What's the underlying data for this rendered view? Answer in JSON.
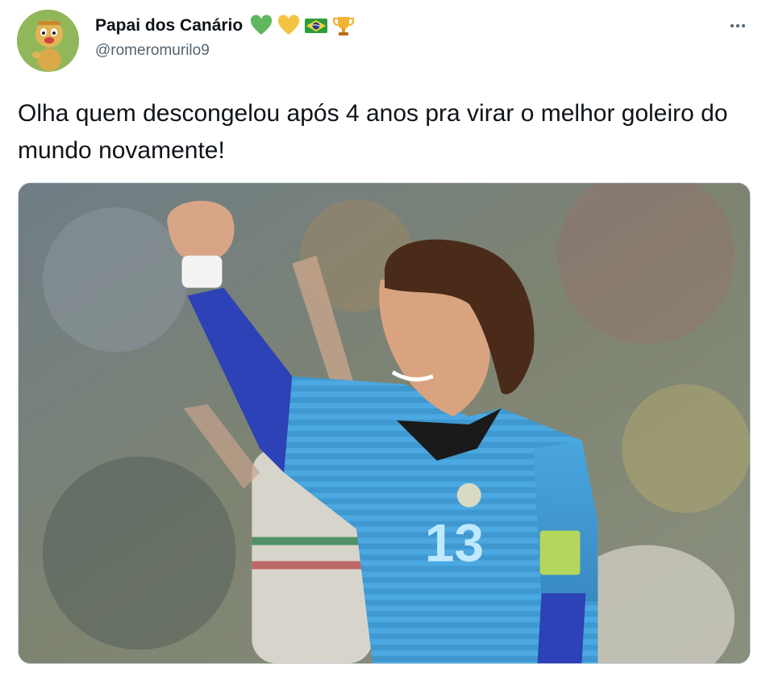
{
  "author": {
    "display_name": "Papai dos Canário",
    "handle": "@romeromurilo9",
    "badges": [
      "green-heart-emoji",
      "yellow-heart-emoji",
      "brazil-flag-emoji",
      "trophy-emoji"
    ]
  },
  "tweet": {
    "text": "Olha quem descongelou após 4 anos pra virar o melhor goleiro do mundo novamente!"
  },
  "media": {
    "type": "photo",
    "jersey_number": "13"
  },
  "colors": {
    "name_text": "#0f1419",
    "secondary_text": "#536471",
    "border": "#cfd9de",
    "jersey_blue": "#3d9bd2"
  }
}
